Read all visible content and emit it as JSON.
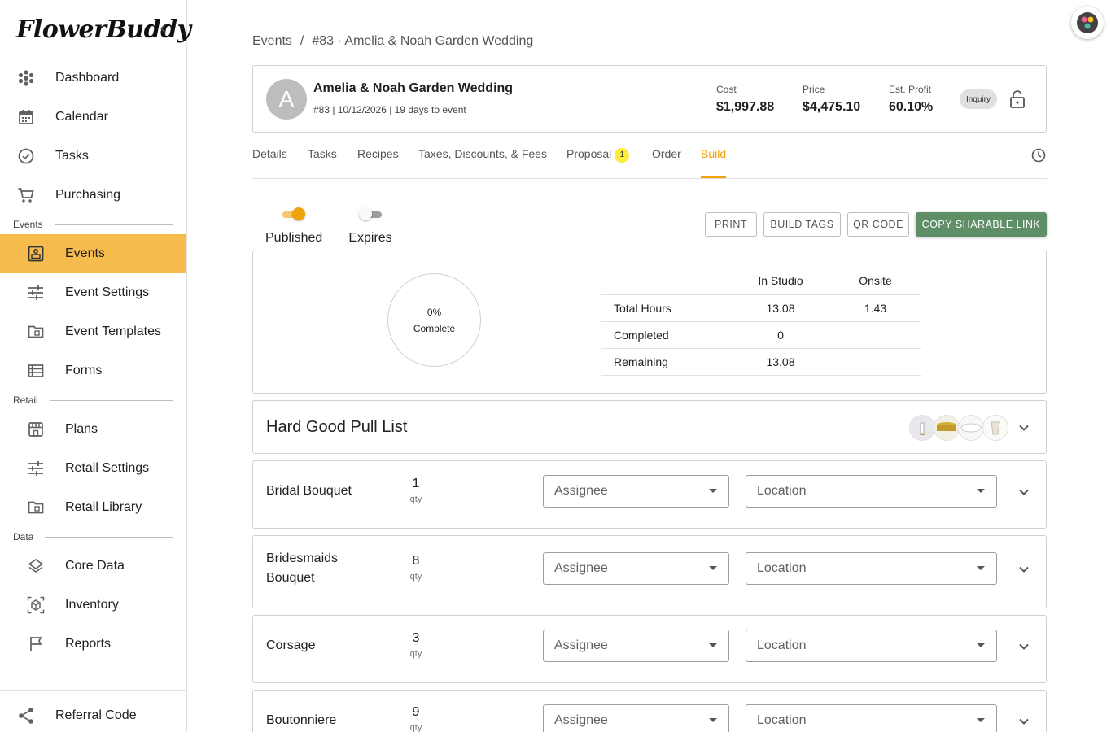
{
  "app": {
    "logo_text": "FlowerBuddy"
  },
  "sidebar": {
    "items_top": [
      {
        "label": "Dashboard",
        "icon": "dashboard-icon"
      },
      {
        "label": "Calendar",
        "icon": "calendar-icon"
      },
      {
        "label": "Tasks",
        "icon": "check-circle-icon"
      },
      {
        "label": "Purchasing",
        "icon": "cart-icon"
      }
    ],
    "section_events": "Events",
    "events_items": [
      {
        "label": "Events",
        "icon": "events-icon"
      },
      {
        "label": "Event Settings",
        "icon": "sliders-icon"
      },
      {
        "label": "Event Templates",
        "icon": "folder-icon"
      },
      {
        "label": "Forms",
        "icon": "list-icon"
      }
    ],
    "section_retail": "Retail",
    "retail_items": [
      {
        "label": "Plans",
        "icon": "store-icon"
      },
      {
        "label": "Retail Settings",
        "icon": "sliders-icon"
      },
      {
        "label": "Retail Library",
        "icon": "folder-icon"
      }
    ],
    "section_data": "Data",
    "data_items": [
      {
        "label": "Core Data",
        "icon": "layers-icon"
      },
      {
        "label": "Inventory",
        "icon": "box-icon"
      },
      {
        "label": "Reports",
        "icon": "flag-icon"
      }
    ],
    "referral": "Referral Code"
  },
  "breadcrumb": {
    "root": "Events",
    "sep": "/",
    "current": "#83 · Amelia & Noah Garden Wedding"
  },
  "event": {
    "avatar_letter": "A",
    "title": "Amelia & Noah Garden Wedding",
    "subtitle": "#83 | 10/12/2026 | 19 days to event",
    "cost_label": "Cost",
    "cost": "$1,997.88",
    "price_label": "Price",
    "price": "$4,475.10",
    "profit_label": "Est. Profit",
    "profit": "60.10%",
    "status": "Inquiry"
  },
  "tabs": [
    {
      "label": "Details"
    },
    {
      "label": "Tasks"
    },
    {
      "label": "Recipes"
    },
    {
      "label": "Taxes, Discounts, & Fees"
    },
    {
      "label": "Proposal",
      "badge": "1"
    },
    {
      "label": "Order"
    },
    {
      "label": "Build",
      "active": true
    }
  ],
  "toggles": {
    "published_label": "Published",
    "published": true,
    "expires_label": "Expires",
    "expires": false
  },
  "buttons": {
    "print": "PRINT",
    "build_tags": "BUILD TAGS",
    "qr_code": "QR CODE",
    "copy_link": "COPY SHARABLE LINK"
  },
  "progress": {
    "percent": "0%",
    "label": "Complete",
    "columns": [
      "",
      "In Studio",
      "Onsite"
    ],
    "rows": [
      [
        "Total Hours",
        "13.08",
        "1.43"
      ],
      [
        "Completed",
        "0",
        ""
      ],
      [
        "Remaining",
        "13.08",
        ""
      ]
    ]
  },
  "pull_list": {
    "title": "Hard Good Pull List"
  },
  "build_items": [
    {
      "name": "Bridal Bouquet",
      "qty": "1",
      "unit": "qty",
      "assignee": "Assignee",
      "location": "Location"
    },
    {
      "name": "Bridesmaids Bouquet",
      "qty": "8",
      "unit": "qty",
      "assignee": "Assignee",
      "location": "Location"
    },
    {
      "name": "Corsage",
      "qty": "3",
      "unit": "qty",
      "assignee": "Assignee",
      "location": "Location"
    },
    {
      "name": "Boutonniere",
      "qty": "9",
      "unit": "qty",
      "assignee": "Assignee",
      "location": "Location"
    }
  ],
  "colors": {
    "accent": "#f0a30a",
    "active_nav": "#f6bb4d",
    "primary_button": "#5f8f66"
  }
}
